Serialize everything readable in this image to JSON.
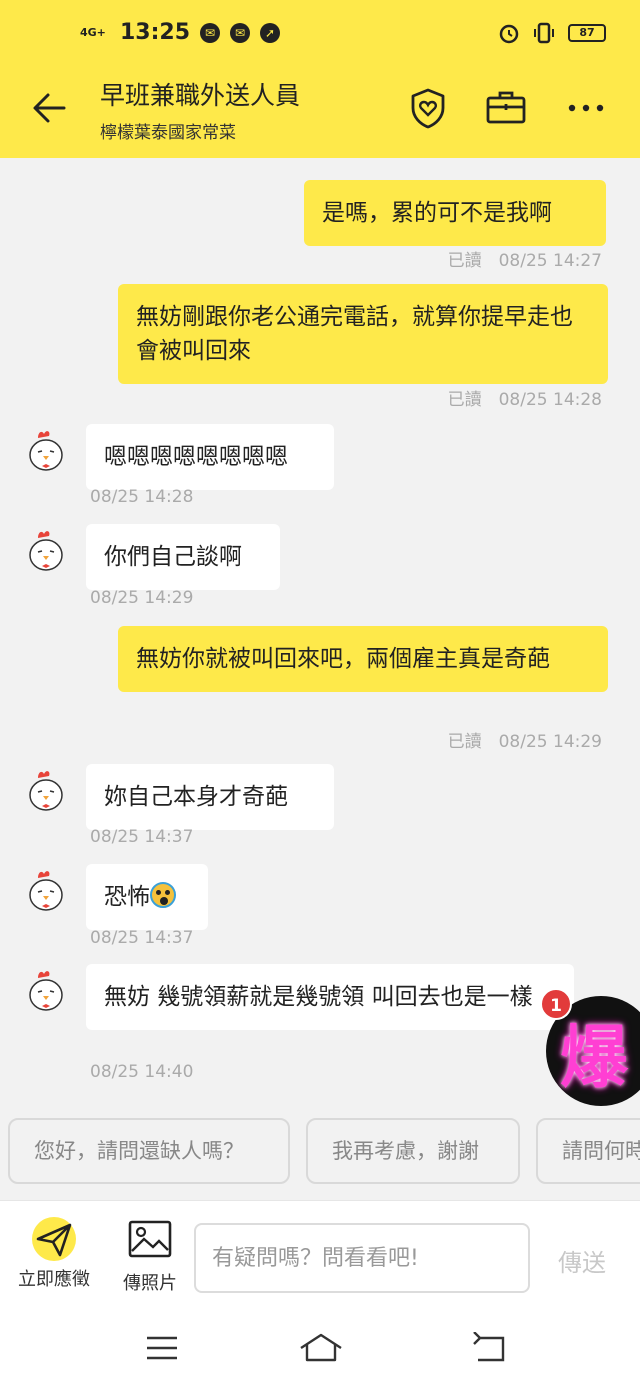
{
  "status_bar": {
    "network": "4G+",
    "time": "13:25",
    "battery": "87"
  },
  "header": {
    "title": "早班兼職外送人員",
    "subtitle": "檸檬葉泰國家常菜"
  },
  "messages": [
    {
      "side": "mine",
      "text": "是嗎，累的可不是我啊",
      "meta": "已讀　08/25 14:27"
    },
    {
      "side": "mine",
      "text": "無妨剛跟你老公通完電話，就算你提早走也會被叫回來",
      "meta": "已讀　08/25 14:28"
    },
    {
      "side": "theirs",
      "text": "嗯嗯嗯嗯嗯嗯嗯嗯",
      "meta": "08/25 14:28"
    },
    {
      "side": "theirs",
      "text": "你們自己談啊",
      "meta": "08/25 14:29"
    },
    {
      "side": "mine",
      "text": "無妨你就被叫回來吧，兩個雇主真是奇葩",
      "meta": "已讀　08/25 14:29"
    },
    {
      "side": "theirs",
      "text": "妳自己本身才奇葩",
      "meta": "08/25 14:37"
    },
    {
      "side": "theirs",
      "text": "恐怖",
      "emoji": "scream-emoji",
      "meta": "08/25 14:37"
    },
    {
      "side": "theirs",
      "text": "無妨 幾號領薪就是幾號領 叫回去也是一樣",
      "meta": "08/25 14:40"
    }
  ],
  "fab": {
    "badge": "1",
    "text": "爆"
  },
  "quick_replies": [
    "您好，請問還缺人嗎？",
    "我再考慮，謝謝",
    "請問何時"
  ],
  "input_bar": {
    "apply_label": "立即應徵",
    "photo_label": "傳照片",
    "placeholder": "有疑問嗎？問看看吧!",
    "send_label": "傳送"
  },
  "colors": {
    "brand_yellow": "#fee94a",
    "bubble_white": "#ffffff",
    "badge_red": "#e23b3b"
  }
}
